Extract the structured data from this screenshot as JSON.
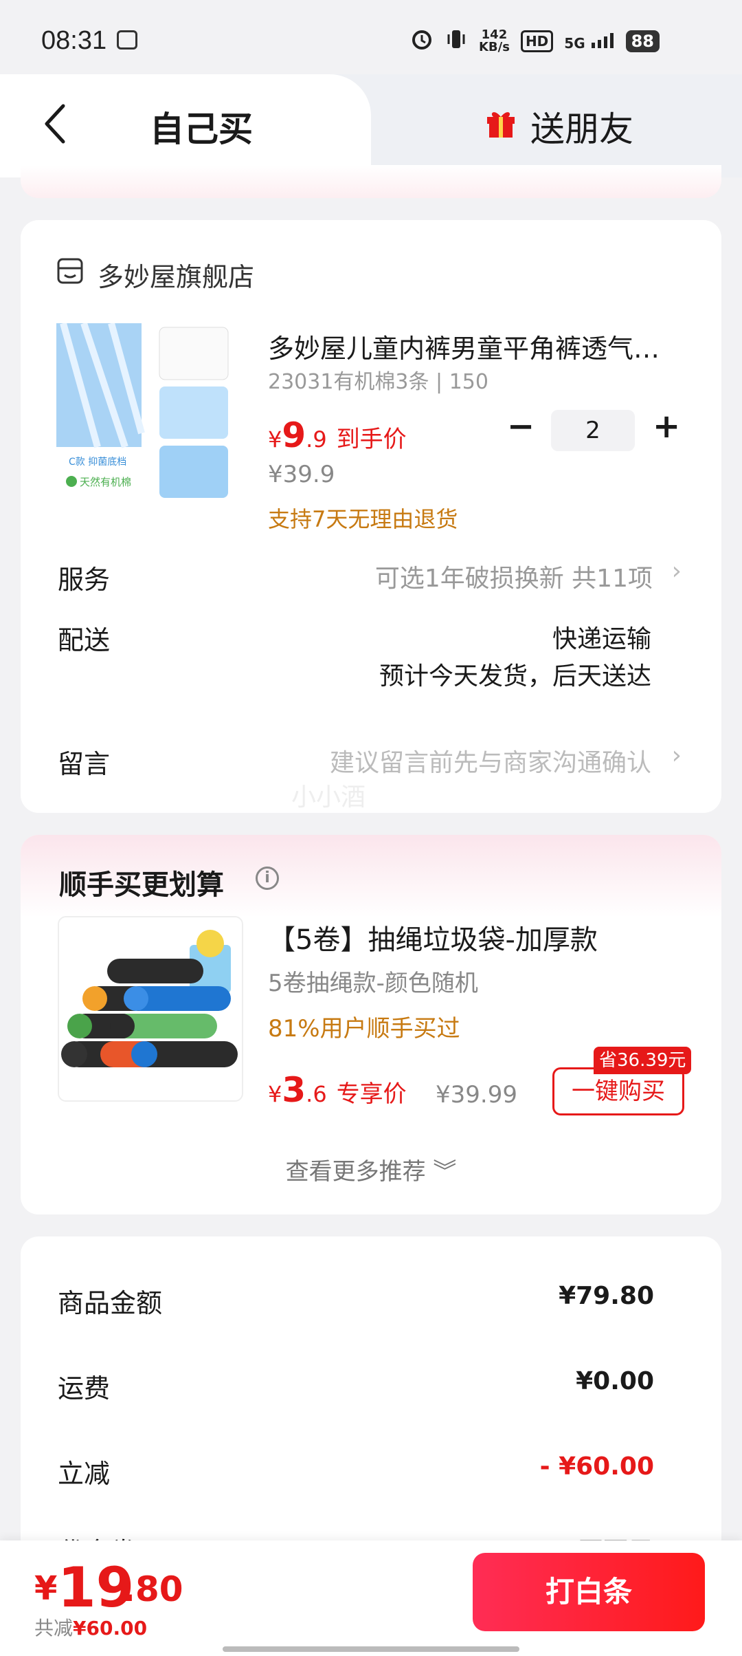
{
  "status_bar": {
    "time": "08:31",
    "net_speed_top": "142",
    "net_speed_bottom": "KB/s",
    "hd": "HD",
    "signal": "5G",
    "battery": "88"
  },
  "tabs": {
    "self": "自己买",
    "gift": "送朋友"
  },
  "store": {
    "name": "多妙屋旗舰店"
  },
  "product": {
    "title": "多妙屋儿童内裤男童平角裤透气…",
    "spec": "23031有机棉3条 | 150",
    "price_symbol": "¥",
    "price_int": "9",
    "price_dec": ".9",
    "price_label": "到手价",
    "original_price": "¥39.9",
    "return_policy": "支持7天无理由退货",
    "quantity": "2",
    "minus": "−",
    "plus": "+",
    "thumb_text_1": "C款 抑菌底档",
    "thumb_text_2": "天然有机棉"
  },
  "rows": {
    "service_label": "服务",
    "service_value": "可选1年破损换新 共11项",
    "delivery_label": "配送",
    "delivery_method": "快递运输",
    "delivery_eta": "预计今天发货，后天送达",
    "note_label": "留言",
    "note_placeholder": "建议留言前先与商家沟通确认",
    "ghost_text": "小小酒"
  },
  "recommend": {
    "title": "顺手买更划算",
    "info": "i",
    "name": "【5卷】抽绳垃圾袋-加厚款",
    "spec": "5卷抽绳款-颜色随机",
    "social": "81%用户顺手买过",
    "price_symbol": "¥",
    "price_int": "3",
    "price_dec": ".6",
    "price_label": "专享价",
    "original_price": "¥39.99",
    "save_tag": "省36.39元",
    "buy_button": "一键购买",
    "more": "查看更多推荐 ︾"
  },
  "summary": {
    "goods_label": "商品金额",
    "goods_value": "¥79.80",
    "shipping_label": "运费",
    "shipping_value": "¥0.00",
    "discount_label": "立减",
    "discount_value": "- ¥60.00",
    "coupon_label": "代金券",
    "coupon_value": "不可用"
  },
  "footer": {
    "yen": "¥",
    "total_int": "19",
    "total_dec": ".80",
    "saved_prefix": "共减",
    "saved_value": "¥60.00",
    "pay_button": "打白条"
  },
  "colors": {
    "accent": "#e61919",
    "orange": "#c77a12",
    "background": "#f2f2f4"
  }
}
